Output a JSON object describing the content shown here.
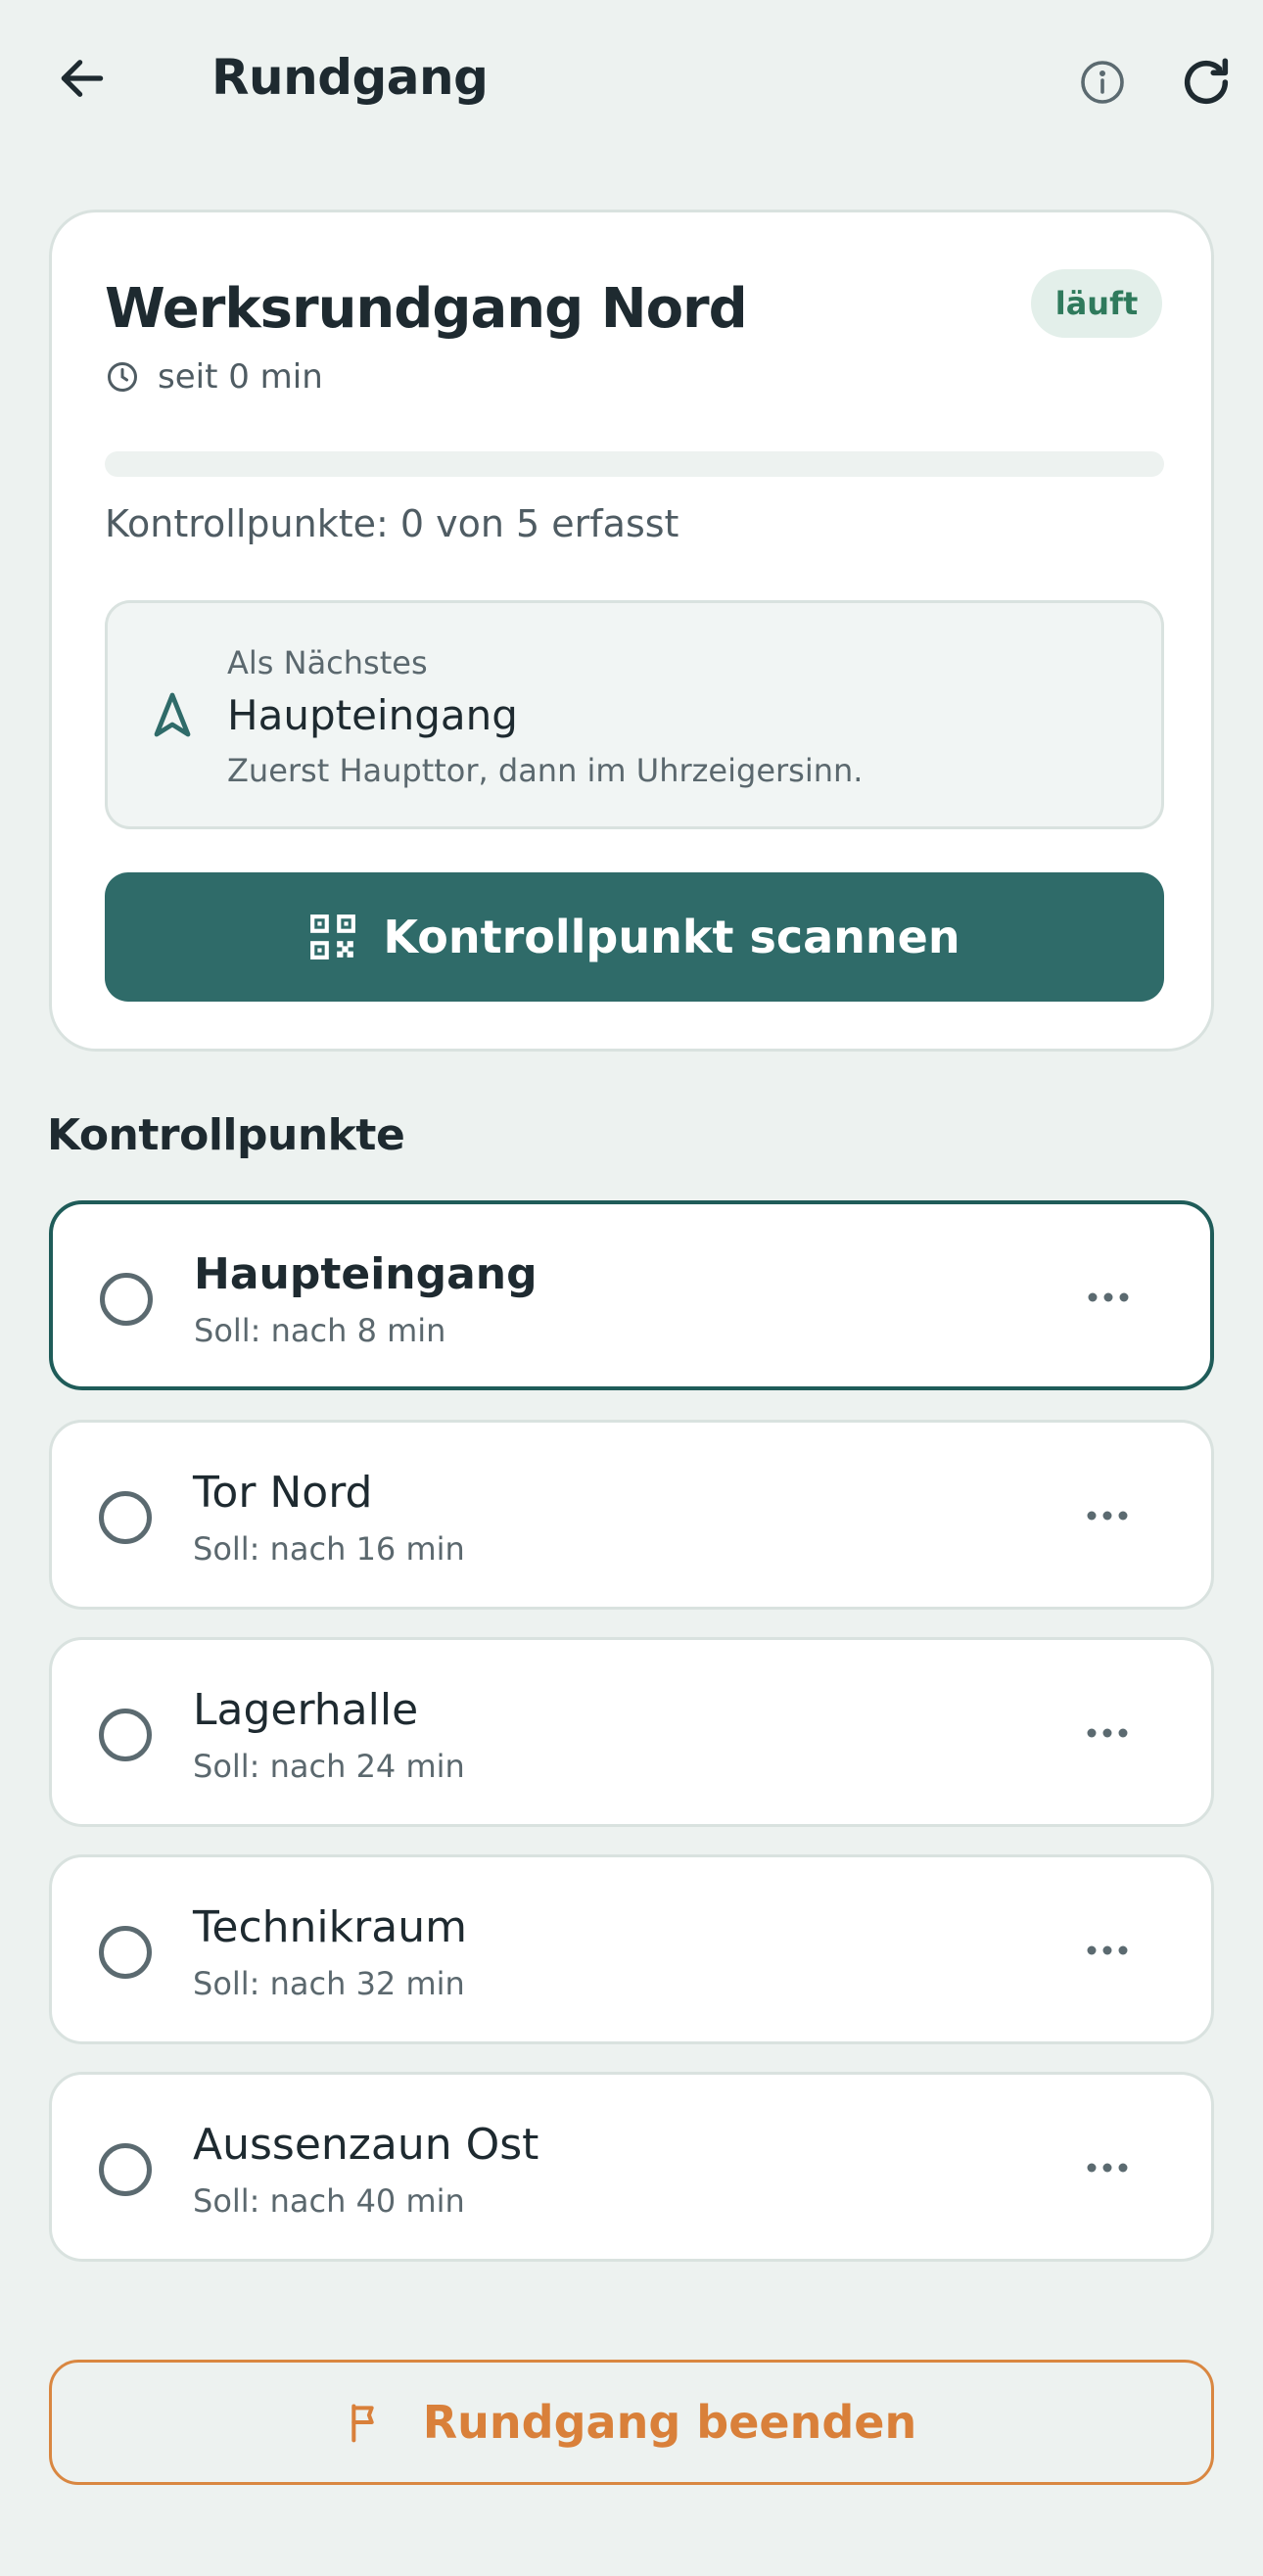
{
  "header": {
    "title": "Rundgang",
    "back_icon": "arrow-left-icon",
    "info_icon": "info-icon",
    "refresh_icon": "refresh-icon"
  },
  "round": {
    "title": "Werksrundgang Nord",
    "status": "läuft",
    "since": "seit 0 min",
    "progress_fraction": 0,
    "progress_text": "Kontrollpunkte: 0 von 5 erfasst",
    "next": {
      "label": "Als Nächstes",
      "name": "Haupteingang",
      "hint": "Zuerst Haupttor, dann im Uhrzeigersinn."
    },
    "scan_button": "Kontrollpunkt scannen"
  },
  "checkpoints": {
    "title": "Kontrollpunkte",
    "items": [
      {
        "name": "Haupteingang",
        "due": "Soll: nach 8 min"
      },
      {
        "name": "Tor Nord",
        "due": "Soll: nach 16 min"
      },
      {
        "name": "Lagerhalle",
        "due": "Soll: nach 24 min"
      },
      {
        "name": "Technikraum",
        "due": "Soll: nach 32 min"
      },
      {
        "name": "Aussenzaun Ost",
        "due": "Soll: nach 40 min"
      }
    ]
  },
  "end_button": "Rundgang beenden",
  "colors": {
    "primary": "#2f6b69",
    "accent_orange": "#d9803a",
    "background": "#edf2f0",
    "status_green": "#2f7a5c"
  }
}
